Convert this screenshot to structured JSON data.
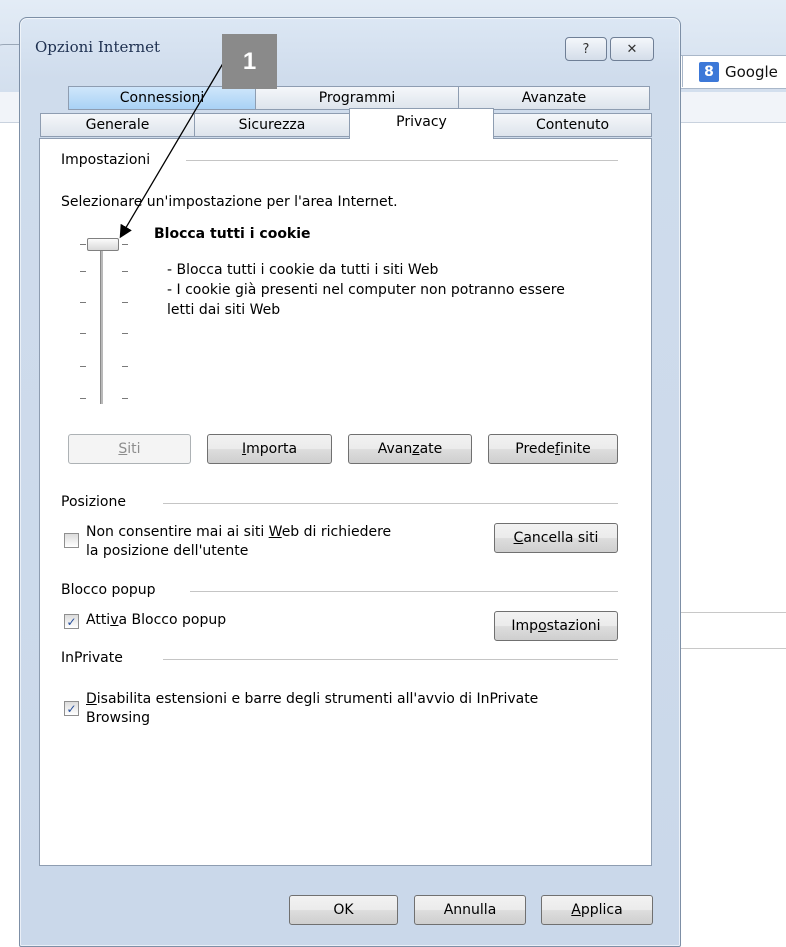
{
  "browser": {
    "search_engine": "Google"
  },
  "window": {
    "title": "Opzioni Internet",
    "help_label": "?",
    "close_label": "✕"
  },
  "callout": {
    "number": "1"
  },
  "tabs": {
    "row_back": [
      {
        "label": "Connessioni"
      },
      {
        "label": "Programmi"
      },
      {
        "label": "Avanzate"
      }
    ],
    "row_front": [
      {
        "label": "Generale"
      },
      {
        "label": "Sicurezza"
      },
      {
        "label": "Privacy"
      },
      {
        "label": "Contenuto"
      }
    ],
    "active": "Privacy"
  },
  "impostazioni": {
    "header": "Impostazioni",
    "prompt": "Selezionare un'impostazione per l'area Internet.",
    "level_title": "Blocca tutti i cookie",
    "level_desc": [
      "- Blocca tutti i cookie da tutti i siti Web",
      "- I cookie già presenti nel computer non potranno essere",
      "letti dai siti Web"
    ],
    "slider_level": 1,
    "slider_levels_total": 6,
    "buttons": {
      "siti": {
        "pre": "",
        "key": "S",
        "post": "iti"
      },
      "importa": {
        "pre": "",
        "key": "I",
        "post": "mporta"
      },
      "avanzate": {
        "pre": "Avan",
        "key": "z",
        "post": "ate"
      },
      "predefinite": {
        "pre": "Prede",
        "key": "f",
        "post": "inite"
      }
    }
  },
  "posizione": {
    "header": "Posizione",
    "checkbox_line1_pre": "Non consentire mai ai siti ",
    "checkbox_line1_key": "W",
    "checkbox_line1_post": "eb di richiedere",
    "checkbox_line2": "la posizione dell'utente",
    "checked": false,
    "button": {
      "pre": "",
      "key": "C",
      "post": "ancella siti"
    }
  },
  "popup": {
    "header": "Blocco popup",
    "checkbox_pre": "Atti",
    "checkbox_key": "v",
    "checkbox_post": "a Blocco popup",
    "checked": true,
    "button": {
      "pre": "Imp",
      "key": "o",
      "post": "stazioni"
    }
  },
  "inprivate": {
    "header": "InPrivate",
    "checkbox_key": "D",
    "checkbox_line1_post": "isabilita estensioni e barre degli strumenti all'avvio di InPrivate",
    "checkbox_line2": "Browsing",
    "checked": true
  },
  "footer": {
    "ok": "OK",
    "annulla": "Annulla",
    "applica": {
      "pre": "",
      "key": "A",
      "post": "pplica"
    }
  }
}
